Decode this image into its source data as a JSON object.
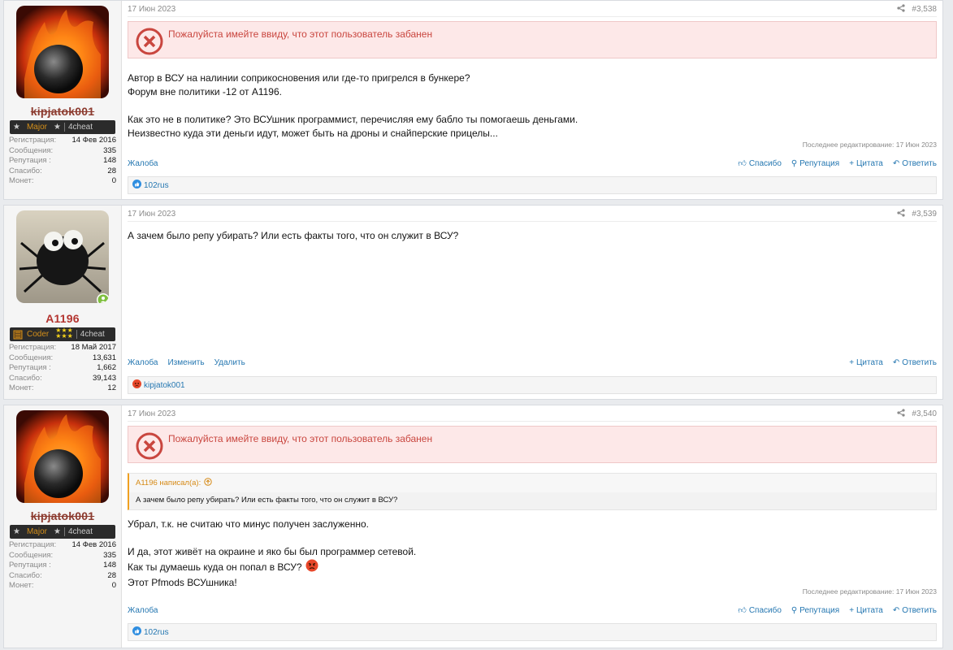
{
  "posts": [
    {
      "date": "17 Июн 2023",
      "number": "#3,538",
      "banned_notice": "Пожалуйста имейте ввиду, что этот пользователь забанен",
      "user": {
        "name": "kipjatok001",
        "rank": "Major",
        "rank_badge": "4cheat",
        "stats": {
          "reg_label": "Регистрация:",
          "reg": "14 Фев 2016",
          "msgs_label": "Сообщения:",
          "msgs": "335",
          "rep_label": "Репутация :",
          "rep": "148",
          "thanks_label": "Спасибо:",
          "thanks": "28",
          "coins_label": "Монет:",
          "coins": "0"
        }
      },
      "body": [
        "Автор в ВСУ на налинии соприкосновения или где-то пригрелся в бункере?",
        "Форум вне политики -12 от A1196.",
        "",
        "Как это не в политике? Это ВСУшник программист, перечисляя ему бабло ты помогаешь деньгами.",
        "Неизвестно куда эти деньги идут, может быть на дроны и снайперские прицелы..."
      ],
      "edited": "Последнее редактирование: 17 Июн 2023",
      "actions_left": [
        "Жалоба"
      ],
      "actions_right": [
        "Спасибо",
        "Репутация",
        "Цитата",
        "Ответить"
      ],
      "reactions": "102rus"
    },
    {
      "date": "17 Июн 2023",
      "number": "#3,539",
      "user": {
        "name": "A1196",
        "rank": "Coder",
        "rank_badge": "4cheat",
        "stats": {
          "reg_label": "Регистрация:",
          "reg": "18 Май 2017",
          "msgs_label": "Сообщения:",
          "msgs": "13,631",
          "rep_label": "Репутация :",
          "rep": "1,662",
          "thanks_label": "Спасибо:",
          "thanks": "39,143",
          "coins_label": "Монет:",
          "coins": "12"
        }
      },
      "body": [
        "А зачем было репу убирать? Или есть факты того, что он служит в ВСУ?"
      ],
      "actions_left": [
        "Жалоба",
        "Изменить",
        "Удалить"
      ],
      "actions_right": [
        "Цитата",
        "Ответить"
      ],
      "reactions": "kipjatok001"
    },
    {
      "date": "17 Июн 2023",
      "number": "#3,540",
      "banned_notice": "Пожалуйста имейте ввиду, что этот пользователь забанен",
      "user": {
        "name": "kipjatok001",
        "rank": "Major",
        "rank_badge": "4cheat",
        "stats": {
          "reg_label": "Регистрация:",
          "reg": "14 Фев 2016",
          "msgs_label": "Сообщения:",
          "msgs": "335",
          "rep_label": "Репутация :",
          "rep": "148",
          "thanks_label": "Спасибо:",
          "thanks": "28",
          "coins_label": "Монет:",
          "coins": "0"
        }
      },
      "quote": {
        "author": "A1196 написал(а):",
        "text": "А зачем было репу убирать? Или есть факты того, что он служит в ВСУ?"
      },
      "body": [
        "Убрал, т.к. не считаю что минус получен заслуженно.",
        "",
        "И да, этот живёт на окраине и яко бы был программер сетевой.",
        "Как ты думаешь куда он попал в ВСУ?",
        "Этот Pfmods ВСУшника!"
      ],
      "edited": "Последнее редактирование: 17 Июн 2023",
      "actions_left": [
        "Жалоба"
      ],
      "actions_right": [
        "Спасибо",
        "Репутация",
        "Цитата",
        "Ответить"
      ],
      "reactions": "102rus"
    }
  ],
  "colors": {
    "link": "#2577b1",
    "banned_bg": "#fde8e8",
    "banned_text": "#c9463f",
    "username": "#b3342f",
    "rank": "#d48f1a"
  }
}
